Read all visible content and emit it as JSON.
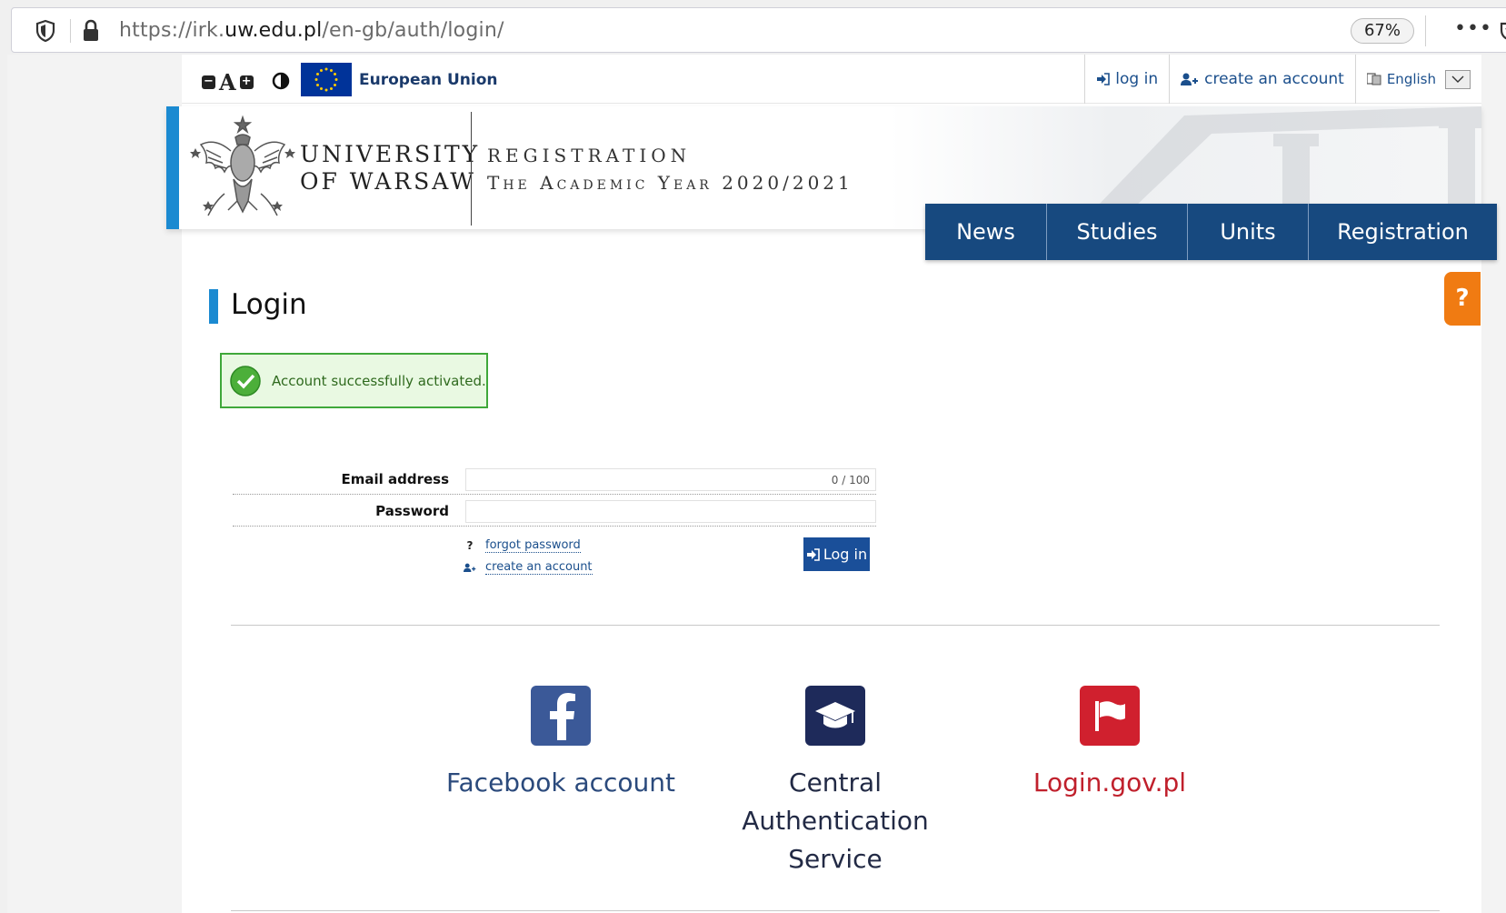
{
  "browser": {
    "url_prefix": "https://irk.",
    "url_domain": "uw.edu.pl",
    "url_path": "/en-gb/auth/login/",
    "zoom": "67%",
    "more": "•••"
  },
  "utility": {
    "font_decrease": "−",
    "font_label": "A",
    "font_increase": "+",
    "eu_label": "European Union",
    "login_link": "log in",
    "create_account_link": "create an account",
    "language": "English"
  },
  "header": {
    "uw_line1": "UNIVERSITY",
    "uw_line2": "OF WARSAW",
    "reg_line1": "REGISTRATION",
    "reg_line2": "The Academic Year 2020/2021"
  },
  "nav": {
    "items": [
      {
        "label": "News"
      },
      {
        "label": "Studies"
      },
      {
        "label": "Units"
      },
      {
        "label": "Registration"
      }
    ]
  },
  "help": {
    "label": "?"
  },
  "main": {
    "title": "Login",
    "alert": "Account successfully activated.",
    "email_label": "Email address",
    "email_counter": "0 / 100",
    "password_label": "Password",
    "forgot_icon": "?",
    "forgot_password": "forgot password",
    "create_account": "create an account",
    "login_button": "Log in"
  },
  "external": {
    "facebook": "Facebook account",
    "cas_line1": "Central",
    "cas_line2": "Authentication",
    "cas_line3": "Service",
    "logingov": "Login.gov.pl"
  },
  "colors": {
    "nav_bg": "#17497f",
    "accent_blue": "#1b8ad1",
    "help_orange": "#f07b12",
    "success_green": "#3fa83a",
    "facebook": "#3b5998",
    "cas": "#1e2a5a",
    "logingov": "#d0202e"
  },
  "icons": [
    "shield-icon",
    "lock-icon",
    "pocket-icon",
    "contrast-icon",
    "eu-flag-icon",
    "login-icon",
    "add-user-icon",
    "language-icon",
    "chevron-down-icon",
    "eagle-logo",
    "check-icon",
    "facebook-icon",
    "graduation-cap-icon",
    "flag-icon"
  ]
}
